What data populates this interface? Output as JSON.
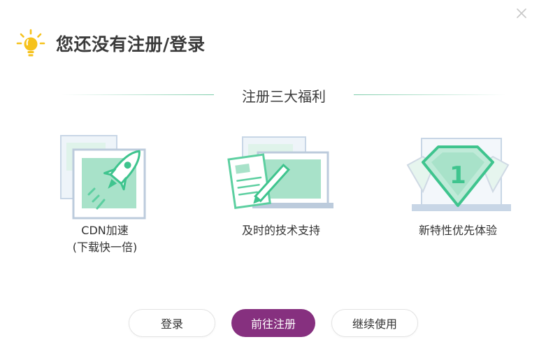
{
  "dialog": {
    "title": "您还没有注册/登录",
    "close_icon": "close-icon",
    "header_icon": "lightbulb-icon"
  },
  "benefits": {
    "heading": "注册三大福利",
    "items": [
      {
        "icon": "rocket-icon",
        "label_line1": "CDN加速",
        "label_line2": "(下载快一倍)"
      },
      {
        "icon": "document-pen-icon",
        "label_line1": "及时的技术支持"
      },
      {
        "icon": "diamond-badge-icon",
        "label_line1": "新特性优先体验"
      }
    ]
  },
  "buttons": {
    "login": "登录",
    "register": "前往注册",
    "continue": "继续使用"
  },
  "colors": {
    "accent_green": "#5ccfa0",
    "primary_button": "#86307f",
    "bulb_yellow": "#f6c21c"
  }
}
